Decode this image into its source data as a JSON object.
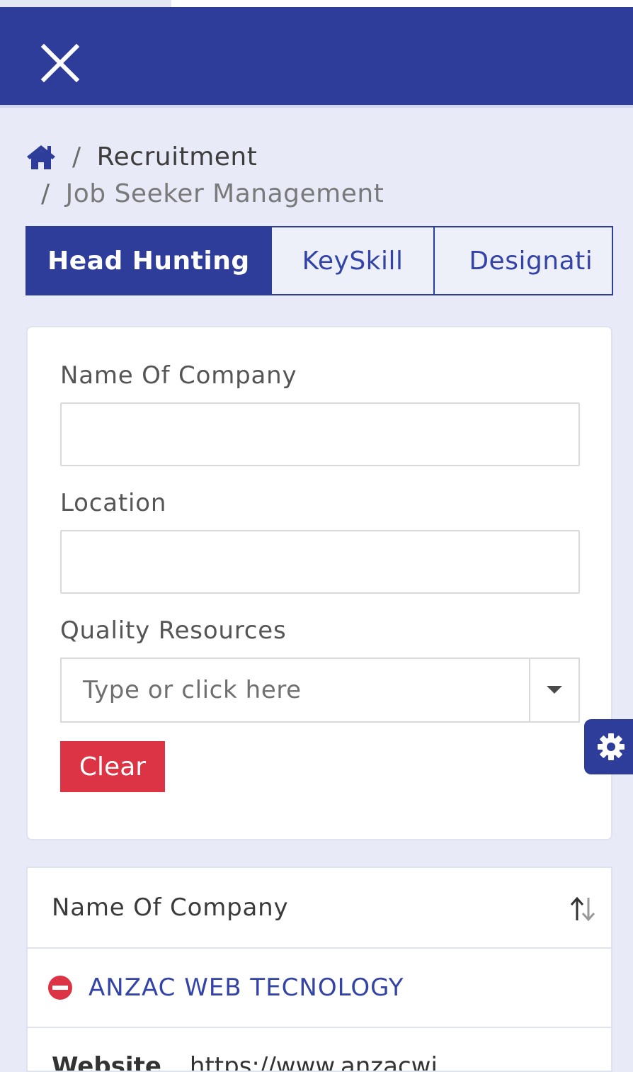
{
  "header": {
    "close_icon": "close-icon"
  },
  "breadcrumb": {
    "home_icon": "home-icon",
    "separator": "/",
    "items": [
      "Recruitment",
      "Job Seeker Management"
    ]
  },
  "tabs": [
    {
      "label": "Head Hunting",
      "active": true
    },
    {
      "label": "KeySkill",
      "active": false
    },
    {
      "label": "Designati",
      "active": false
    }
  ],
  "filters": {
    "company_label": "Name Of Company",
    "company_value": "",
    "location_label": "Location",
    "location_value": "",
    "quality_label": "Quality Resources",
    "quality_placeholder": "Type or click here",
    "clear_label": "Clear"
  },
  "settings": {
    "icon": "gear-icon"
  },
  "table": {
    "header": "Name Of Company",
    "sort_icon": "sort-icon",
    "rows": [
      {
        "company": "ANZAC WEB TECNOLOGY",
        "toggle_icon": "minus-circle-icon"
      }
    ],
    "detail": {
      "label": "Website",
      "value": "https://www.anzacwi..."
    }
  },
  "colors": {
    "primary": "#2e3d99",
    "background": "#e8ebf7",
    "danger": "#dc3445",
    "link": "#3444a6"
  }
}
